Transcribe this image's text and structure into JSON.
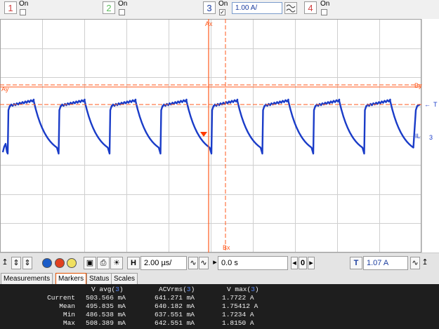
{
  "channels": [
    {
      "number": "1",
      "on_label": "On",
      "checked": false,
      "color": "#d04040"
    },
    {
      "number": "2",
      "on_label": "On",
      "checked": false,
      "color": "#60c060"
    },
    {
      "number": "3",
      "on_label": "On",
      "checked": true,
      "color": "#1a3c9e",
      "scale": "1.00 A/"
    },
    {
      "number": "4",
      "on_label": "On",
      "checked": false,
      "color": "#d04040"
    }
  ],
  "markers": {
    "ax_label": "Ax",
    "bx_label": "Bx",
    "ay_label": "Ay",
    "by_label": "By",
    "trigger_label": "T",
    "channel_label": "IL",
    "channel_num": "3",
    "trigger_arrow": "←"
  },
  "controls": {
    "h_label": "H",
    "time_scale": "2.00 µs/",
    "delay": "0.0 s",
    "delay_index": "0",
    "trigger_label": "T",
    "trigger_level": "1.07 A"
  },
  "tabs": [
    {
      "label": "Measurements",
      "active": false
    },
    {
      "label": "Markers",
      "active": true
    },
    {
      "label": "Status",
      "active": false
    },
    {
      "label": "Scales",
      "active": false
    }
  ],
  "measurements": {
    "headers": [
      "V avg(",
      "3",
      ")",
      "ACVrms(",
      "3",
      ")",
      "V max(",
      "3",
      ")"
    ],
    "h1": "V avg(",
    "h1n": "3",
    "h1c": ")",
    "h2": "ACVrms(",
    "h2n": "3",
    "h2c": ")",
    "h3": "V max(",
    "h3n": "3",
    "h3c": ")",
    "rows": [
      {
        "name": "Current",
        "avg": "503.566 mA",
        "rms": "641.271 mA",
        "max": "1.7722 A"
      },
      {
        "name": "Mean",
        "avg": "495.835 mA",
        "rms": "640.182 mA",
        "max": "1.75412 A"
      },
      {
        "name": "Min",
        "avg": "486.538 mA",
        "rms": "637.551 mA",
        "max": "1.7234 A"
      },
      {
        "name": "Max",
        "avg": "508.389 mA",
        "rms": "642.551 mA",
        "max": "1.8150 A"
      }
    ]
  },
  "colors": {
    "trace": "#1a3cc8",
    "marker_a": "#ff5a1e",
    "marker_b": "#ff5a1e",
    "grid": "#c8c8c8",
    "background": "#ffffff"
  }
}
